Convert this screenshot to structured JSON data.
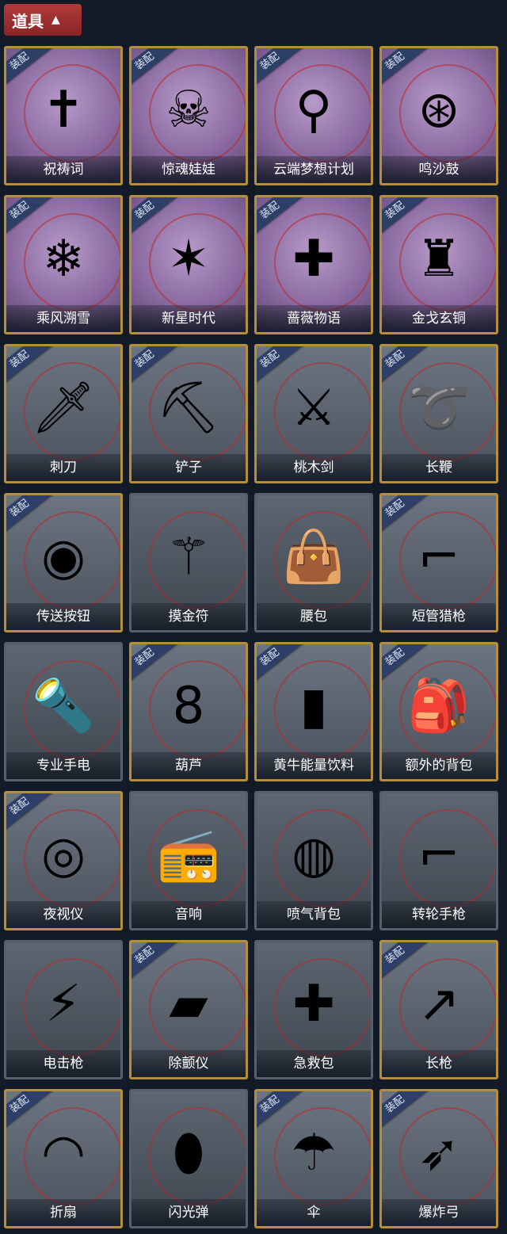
{
  "header": {
    "title": "道具",
    "chevron_icon": "chevron-up-icon"
  },
  "equip_badge": "装配",
  "items": [
    {
      "name": "祝祷词",
      "equipped": true,
      "bg": "purple",
      "glyph": "✝"
    },
    {
      "name": "惊魂娃娃",
      "equipped": true,
      "bg": "purple",
      "glyph": "☠"
    },
    {
      "name": "云端梦想计划",
      "equipped": true,
      "bg": "purple",
      "glyph": "⚲"
    },
    {
      "name": "鸣沙鼓",
      "equipped": true,
      "bg": "purple",
      "glyph": "⊛"
    },
    {
      "name": "乘风溯雪",
      "equipped": true,
      "bg": "purple",
      "glyph": "❄"
    },
    {
      "name": "新星时代",
      "equipped": true,
      "bg": "purple",
      "glyph": "✶"
    },
    {
      "name": "蔷薇物语",
      "equipped": true,
      "bg": "purple",
      "glyph": "✚"
    },
    {
      "name": "金戈玄铜",
      "equipped": true,
      "bg": "purple",
      "glyph": "♜"
    },
    {
      "name": "刺刀",
      "equipped": true,
      "bg": "gray",
      "glyph": "🗡"
    },
    {
      "name": "铲子",
      "equipped": true,
      "bg": "gray",
      "glyph": "⛏"
    },
    {
      "name": "桃木剑",
      "equipped": true,
      "bg": "gray",
      "glyph": "⚔"
    },
    {
      "name": "长鞭",
      "equipped": true,
      "bg": "gray",
      "glyph": "➰"
    },
    {
      "name": "传送按钮",
      "equipped": true,
      "bg": "gray",
      "glyph": "◉"
    },
    {
      "name": "摸金符",
      "equipped": false,
      "bg": "gray",
      "glyph": "⚚"
    },
    {
      "name": "腰包",
      "equipped": false,
      "bg": "gray",
      "glyph": "👜"
    },
    {
      "name": "短管猎枪",
      "equipped": true,
      "bg": "gray",
      "glyph": "⌐"
    },
    {
      "name": "专业手电",
      "equipped": false,
      "bg": "gray",
      "glyph": "🔦"
    },
    {
      "name": "葫芦",
      "equipped": true,
      "bg": "gray",
      "glyph": "8"
    },
    {
      "name": "黄牛能量饮料",
      "equipped": true,
      "bg": "gray",
      "glyph": "▮"
    },
    {
      "name": "额外的背包",
      "equipped": true,
      "bg": "gray",
      "glyph": "🎒"
    },
    {
      "name": "夜视仪",
      "equipped": true,
      "bg": "gray",
      "glyph": "◎"
    },
    {
      "name": "音响",
      "equipped": false,
      "bg": "gray",
      "glyph": "📻"
    },
    {
      "name": "喷气背包",
      "equipped": false,
      "bg": "gray",
      "glyph": "◍"
    },
    {
      "name": "转轮手枪",
      "equipped": false,
      "bg": "gray",
      "glyph": "⌐"
    },
    {
      "name": "电击枪",
      "equipped": false,
      "bg": "gray",
      "glyph": "⚡"
    },
    {
      "name": "除颤仪",
      "equipped": true,
      "bg": "gray",
      "glyph": "▰"
    },
    {
      "name": "急救包",
      "equipped": false,
      "bg": "gray",
      "glyph": "✚"
    },
    {
      "name": "长枪",
      "equipped": true,
      "bg": "gray",
      "glyph": "↗"
    },
    {
      "name": "折扇",
      "equipped": true,
      "bg": "gray",
      "glyph": "◠"
    },
    {
      "name": "闪光弹",
      "equipped": false,
      "bg": "gray",
      "glyph": "⬮"
    },
    {
      "name": "伞",
      "equipped": true,
      "bg": "gray",
      "glyph": "☂"
    },
    {
      "name": "爆炸弓",
      "equipped": true,
      "bg": "gray",
      "glyph": "➶"
    }
  ],
  "icons": [
    "prayer-cross-icon",
    "skull-doll-icon",
    "cloud-wand-icon",
    "sand-drum-icon",
    "snow-lantern-icon",
    "revolver-icon",
    "rose-medkit-icon",
    "bronze-grenade-icon",
    "bayonet-icon",
    "shovel-icon",
    "peach-wood-sword-icon",
    "whip-icon",
    "teleport-button-icon",
    "talisman-icon",
    "waist-bag-icon",
    "shotgun-icon",
    "flashlight-icon",
    "gourd-icon",
    "energy-drink-icon",
    "backpack-icon",
    "night-vision-icon",
    "speaker-icon",
    "jetpack-icon",
    "revolver-icon",
    "stun-gun-icon",
    "defibrillator-icon",
    "first-aid-kit-icon",
    "spear-icon",
    "folding-fan-icon",
    "flashbang-icon",
    "umbrella-icon",
    "explosive-bow-icon"
  ]
}
